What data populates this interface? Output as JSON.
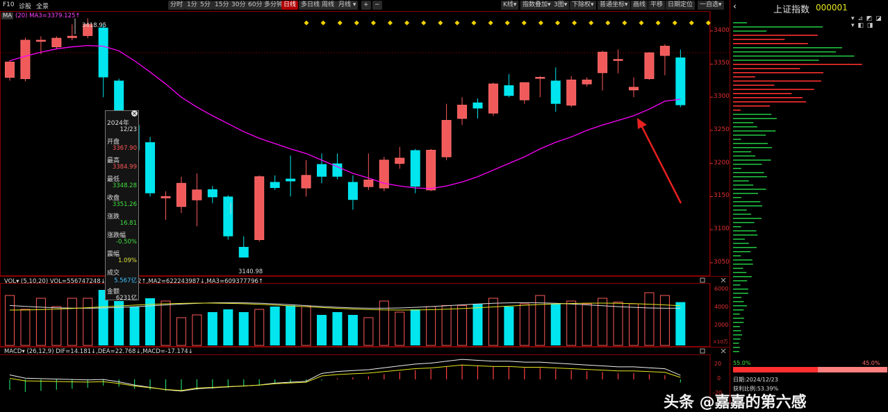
{
  "toolbar": {
    "left_links": [
      "F10",
      "诊股",
      "全景"
    ],
    "periods": [
      "分时",
      "1分",
      "5分",
      "15分",
      "30分",
      "60分",
      "多分钟",
      "日线",
      "多日线",
      "周线",
      "月线"
    ],
    "active_period": "日线",
    "plus": "+",
    "minus": "−",
    "right_buttons": [
      "K线",
      "指数叠加",
      "3图",
      "下除权",
      "普通坐标",
      "画线",
      "平移",
      "日期定位",
      "一自选"
    ]
  },
  "main": {
    "ma_tag": "MA",
    "ma_label": "(20)  MA3=3379.125↑",
    "high_marker": "3418.95",
    "low_marker": "3140.98",
    "y_ticks": [
      "3400",
      "3350",
      "3300",
      "3250",
      "3200",
      "3150",
      "3100",
      "3050"
    ]
  },
  "popup": {
    "year": "2024年",
    "date": "12/23",
    "open_label": "开盘",
    "open": "3367.90",
    "high_label": "最高",
    "high": "3384.99",
    "low_label": "最低",
    "low": "3348.28",
    "close_label": "收盘",
    "close": "3351.26",
    "change_label": "涨跌",
    "change": "16.81",
    "pct_label": "涨跌幅",
    "pct": "-0.50%",
    "amp_label": "震幅",
    "amp": "1.09%",
    "vol_label": "成交",
    "vol": "5.567亿",
    "amt_label": "金额",
    "amt": "6231亿"
  },
  "volume": {
    "label": "VOL▾  (5,10,20)  VOL=556747248↓ MA",
    "ma2": "2↑,MA2=622243987↓,MA3=609377796↑",
    "y_ticks": [
      "6000",
      "4000",
      "2000",
      "×10万"
    ]
  },
  "macd": {
    "label": "MACD▾  (26,12,9)  DIF=14.181↓,DEA=22.768↓,MACD=-17.174↓",
    "y_ticks": [
      "20",
      "0",
      "-20"
    ]
  },
  "right_panel": {
    "title": "上证指数",
    "code": "000001",
    "left_pct": "55.0%",
    "right_pct": "45.0%",
    "date_line": "日期:2024/12/23",
    "profit_line": "获利比例:53.39%"
  },
  "watermark": "头条 @嘉嘉的第六感",
  "colors": {
    "up": "#ff5a5a",
    "down": "#00e5ee",
    "ma": "#ff00ff",
    "grid": "#8b0000",
    "arrow": "#e82020"
  },
  "chart_data": {
    "type": "candlestick",
    "y_range": [
      3030,
      3430
    ],
    "days": 43,
    "candles": [
      {
        "o": 3330,
        "h": 3355,
        "l": 3325,
        "c": 3353
      },
      {
        "o": 3328,
        "h": 3390,
        "l": 3324,
        "c": 3386
      },
      {
        "o": 3385,
        "h": 3392,
        "l": 3365,
        "c": 3386
      },
      {
        "o": 3376,
        "h": 3392,
        "l": 3372,
        "c": 3389
      },
      {
        "o": 3390,
        "h": 3410,
        "l": 3386,
        "c": 3392
      },
      {
        "o": 3393,
        "h": 3419,
        "l": 3389,
        "c": 3410
      },
      {
        "o": 3405,
        "h": 3410,
        "l": 3300,
        "c": 3330
      },
      {
        "o": 3325,
        "h": 3328,
        "l": 3240,
        "c": 3255
      },
      {
        "o": 3258,
        "h": 3262,
        "l": 3206,
        "c": 3220
      },
      {
        "o": 3232,
        "h": 3240,
        "l": 3150,
        "c": 3155
      },
      {
        "o": 3148,
        "h": 3158,
        "l": 3115,
        "c": 3150
      },
      {
        "o": 3135,
        "h": 3180,
        "l": 3125,
        "c": 3170
      },
      {
        "o": 3145,
        "h": 3185,
        "l": 3105,
        "c": 3160
      },
      {
        "o": 3161,
        "h": 3166,
        "l": 3140,
        "c": 3149
      },
      {
        "o": 3150,
        "h": 3152,
        "l": 3085,
        "c": 3090
      },
      {
        "o": 3074,
        "h": 3090,
        "l": 3060,
        "c": 3058
      },
      {
        "o": 3085,
        "h": 3182,
        "l": 3082,
        "c": 3180
      },
      {
        "o": 3172,
        "h": 3182,
        "l": 3160,
        "c": 3163
      },
      {
        "o": 3177,
        "h": 3212,
        "l": 3150,
        "c": 3173
      },
      {
        "o": 3163,
        "h": 3205,
        "l": 3150,
        "c": 3182
      },
      {
        "o": 3199,
        "h": 3215,
        "l": 3170,
        "c": 3180
      },
      {
        "o": 3200,
        "h": 3215,
        "l": 3176,
        "c": 3180
      },
      {
        "o": 3172,
        "h": 3182,
        "l": 3130,
        "c": 3145
      },
      {
        "o": 3165,
        "h": 3215,
        "l": 3160,
        "c": 3175
      },
      {
        "o": 3163,
        "h": 3210,
        "l": 3158,
        "c": 3205
      },
      {
        "o": 3200,
        "h": 3225,
        "l": 3192,
        "c": 3208
      },
      {
        "o": 3220,
        "h": 3222,
        "l": 3155,
        "c": 3165
      },
      {
        "o": 3160,
        "h": 3222,
        "l": 3158,
        "c": 3220
      },
      {
        "o": 3210,
        "h": 3290,
        "l": 3205,
        "c": 3265
      },
      {
        "o": 3268,
        "h": 3300,
        "l": 3258,
        "c": 3288
      },
      {
        "o": 3292,
        "h": 3298,
        "l": 3268,
        "c": 3283
      },
      {
        "o": 3276,
        "h": 3322,
        "l": 3272,
        "c": 3320
      },
      {
        "o": 3318,
        "h": 3335,
        "l": 3300,
        "c": 3302
      },
      {
        "o": 3296,
        "h": 3320,
        "l": 3290,
        "c": 3322
      },
      {
        "o": 3330,
        "h": 3332,
        "l": 3300,
        "c": 3330
      },
      {
        "o": 3325,
        "h": 3345,
        "l": 3278,
        "c": 3290
      },
      {
        "o": 3288,
        "h": 3332,
        "l": 3285,
        "c": 3326
      },
      {
        "o": 3320,
        "h": 3330,
        "l": 3316,
        "c": 3326
      },
      {
        "o": 3337,
        "h": 3370,
        "l": 3310,
        "c": 3368
      },
      {
        "o": 3356,
        "h": 3372,
        "l": 3336,
        "c": 3357
      },
      {
        "o": 3311,
        "h": 3330,
        "l": 3300,
        "c": 3315
      },
      {
        "o": 3328,
        "h": 3368,
        "l": 3326,
        "c": 3367
      },
      {
        "o": 3363,
        "h": 3380,
        "l": 3333,
        "c": 3377
      },
      {
        "o": 3360,
        "h": 3372,
        "l": 3285,
        "c": 3288
      }
    ],
    "ma20": [
      3355,
      3362,
      3368,
      3373,
      3376,
      3378,
      3377,
      3370,
      3355,
      3338,
      3320,
      3300,
      3285,
      3272,
      3260,
      3248,
      3238,
      3230,
      3222,
      3215,
      3205,
      3195,
      3185,
      3178,
      3170,
      3166,
      3163,
      3162,
      3166,
      3172,
      3180,
      3190,
      3200,
      3210,
      3222,
      3232,
      3240,
      3250,
      3258,
      3265,
      3272,
      3282,
      3294,
      3297
    ],
    "volume": [
      0.9,
      0.65,
      0.85,
      0.7,
      0.85,
      0.85,
      1.0,
      0.8,
      0.7,
      0.85,
      0.8,
      0.5,
      0.55,
      0.6,
      0.65,
      0.6,
      0.65,
      0.7,
      0.72,
      0.7,
      0.55,
      0.6,
      0.55,
      0.5,
      0.8,
      0.6,
      0.65,
      0.7,
      0.72,
      0.72,
      0.75,
      0.85,
      0.7,
      0.75,
      0.9,
      0.75,
      0.8,
      0.75,
      0.85,
      0.78,
      0.75,
      0.95,
      0.9,
      0.78
    ],
    "macd_hist": [
      -0.5,
      -0.6,
      -0.55,
      -0.5,
      -0.45,
      -0.4,
      -0.3,
      -0.35,
      -0.45,
      -0.5,
      -0.55,
      -0.55,
      -0.5,
      -0.45,
      -0.4,
      -0.35,
      -0.3,
      -0.2,
      -0.15,
      -0.1,
      -0.05,
      0.05,
      0.1,
      0.15,
      0.25,
      0.35,
      0.45,
      0.5,
      0.6,
      0.7,
      0.65,
      0.6,
      0.6,
      0.55,
      0.55,
      0.5,
      0.45,
      0.4,
      0.35,
      0.3,
      0.3,
      0.25,
      0.2,
      -0.15
    ]
  }
}
